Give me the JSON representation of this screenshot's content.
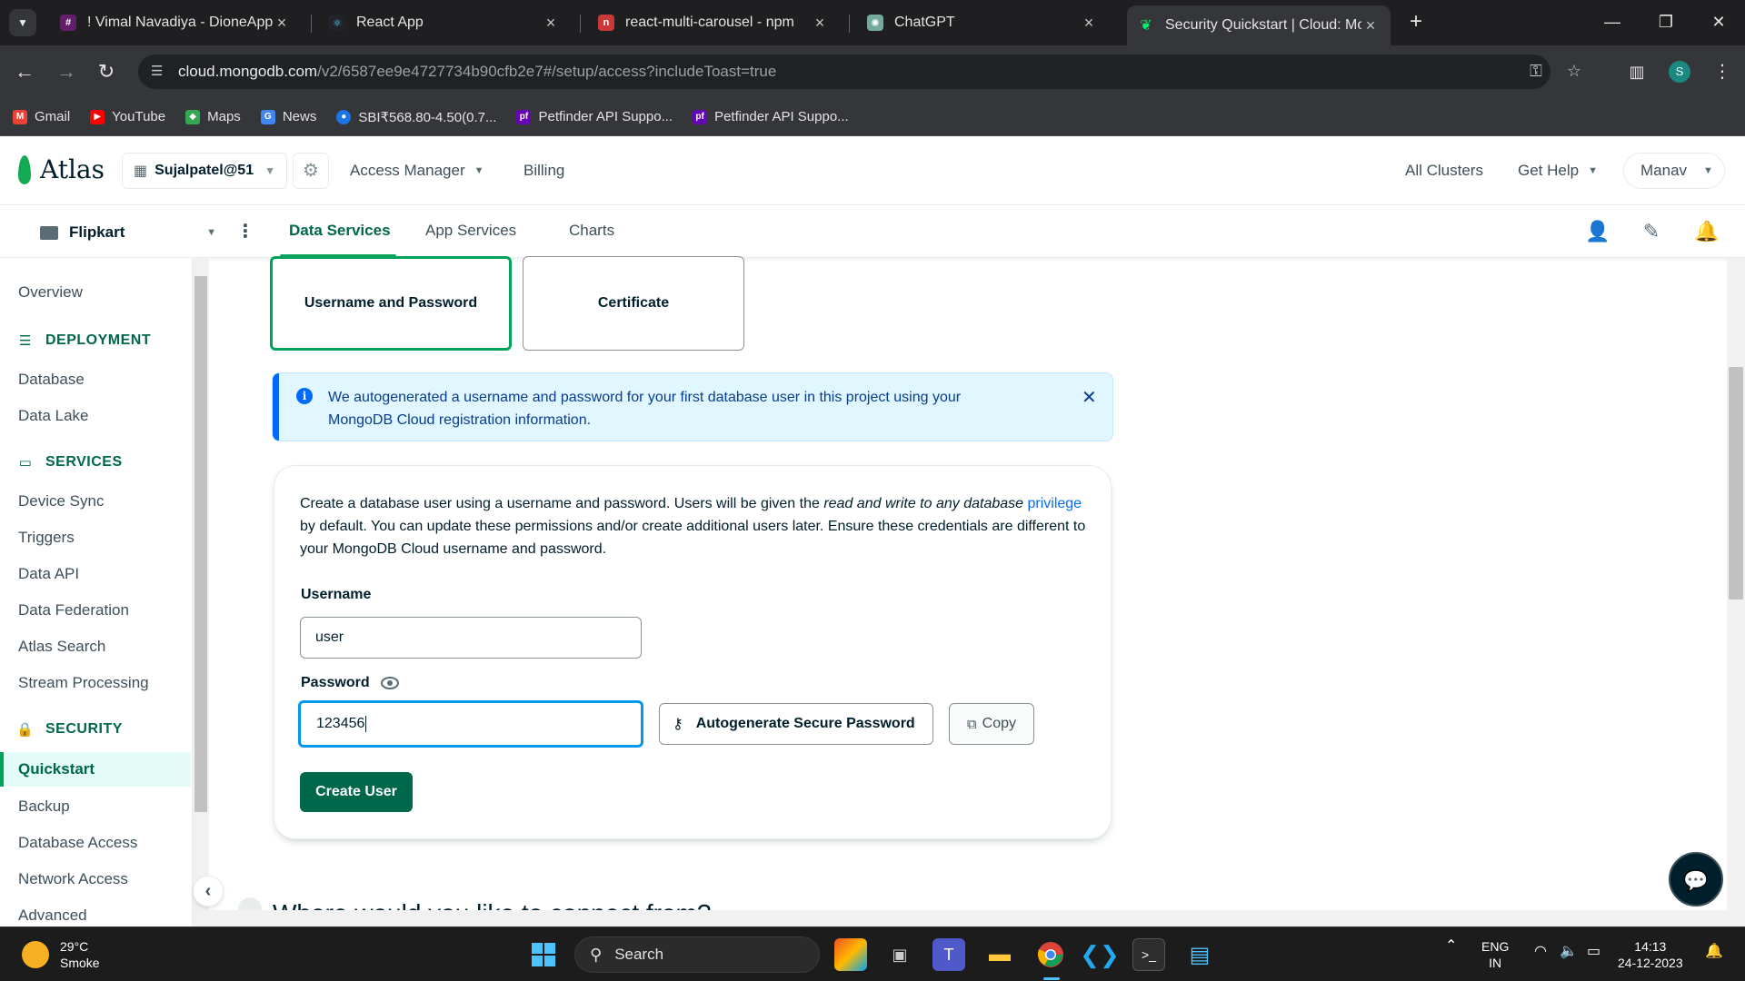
{
  "browser": {
    "tabs": [
      {
        "title": "! Vimal Navadiya - DioneApps -",
        "favicon": "slack-icon",
        "color": "#611f69"
      },
      {
        "title": "React App",
        "favicon": "react-icon",
        "color": "#20232a"
      },
      {
        "title": "react-multi-carousel - npm",
        "favicon": "npm-icon",
        "color": "#cb3837"
      },
      {
        "title": "ChatGPT",
        "favicon": "chatgpt-icon",
        "color": "#74aa9c"
      },
      {
        "title": "Security Quickstart | Cloud: Mo",
        "favicon": "mongodb-leaf-icon",
        "color": "#00ed64",
        "active": true
      }
    ],
    "url_host": "cloud.mongodb.com",
    "url_path": "/v2/6587ee9e4727734b90cfb2e7#/setup/access?includeToast=true",
    "profile_initial": "S",
    "bookmarks": [
      {
        "label": "Gmail",
        "icon": "gmail-icon",
        "color": "#ea4335"
      },
      {
        "label": "YouTube",
        "icon": "youtube-icon",
        "color": "#ff0000"
      },
      {
        "label": "Maps",
        "icon": "maps-icon",
        "color": "#34a853"
      },
      {
        "label": "News",
        "icon": "news-icon",
        "color": "#4285f4"
      },
      {
        "label": "SBI₹568.80-4.50(0.7...",
        "icon": "sbi-icon",
        "color": "#1a73e8"
      },
      {
        "label": "Petfinder API Suppo...",
        "icon": "petfinder-icon",
        "color": "#6504b5"
      },
      {
        "label": "Petfinder API Suppo...",
        "icon": "petfinder-icon",
        "color": "#6504b5"
      }
    ]
  },
  "atlas": {
    "logo_text": "Atlas",
    "org_name": "Sujalpatel@51",
    "access_manager": "Access Manager",
    "billing": "Billing",
    "all_clusters": "All Clusters",
    "get_help": "Get Help",
    "user_name": "Manav",
    "project_name": "Flipkart",
    "project_tabs": [
      "Data Services",
      "App Services",
      "Charts"
    ]
  },
  "sidebar": {
    "overview": "Overview",
    "deployment_header": "DEPLOYMENT",
    "deployment_items": [
      "Database",
      "Data Lake"
    ],
    "services_header": "SERVICES",
    "services_items": [
      "Device Sync",
      "Triggers",
      "Data API",
      "Data Federation",
      "Atlas Search",
      "Stream Processing"
    ],
    "security_header": "SECURITY",
    "security_items": [
      "Quickstart",
      "Backup",
      "Database Access",
      "Network Access",
      "Advanced"
    ],
    "active_item": "Quickstart"
  },
  "main": {
    "auth_options": [
      "Username and Password",
      "Certificate"
    ],
    "selected_auth": "Username and Password",
    "banner_text": "We autogenerated a username and password for your first database user in this project using your MongoDB Cloud registration information.",
    "desc_part1": "Create a database user using a username and password. Users will be given the ",
    "desc_italic": "read and write to any database",
    "desc_link": "privilege",
    "desc_part2": " by default. You can update these permissions and/or create additional users later. Ensure these credentials are different to your MongoDB Cloud username and password.",
    "username_label": "Username",
    "username_value": "user",
    "password_label": "Password",
    "password_value": "123456",
    "autogen_button": "Autogenerate Secure Password",
    "copy_button": "Copy",
    "create_button": "Create User",
    "next_heading": "Where would you like to connect from?"
  },
  "taskbar": {
    "temperature": "29°C",
    "weather": "Smoke",
    "search_placeholder": "Search",
    "lang_top": "ENG",
    "lang_bottom": "IN",
    "time": "14:13",
    "date": "24-12-2023"
  },
  "colors": {
    "brand_green": "#00684a",
    "accent_green": "#00a35c",
    "info_blue": "#016bf8",
    "focus_blue": "#0498ec"
  }
}
